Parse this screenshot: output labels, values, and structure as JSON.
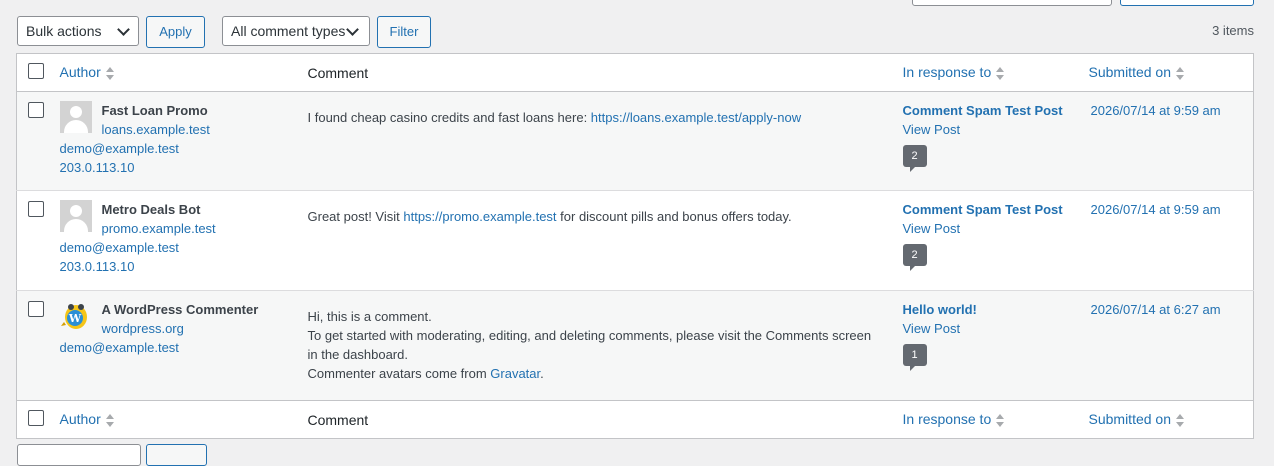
{
  "toolbar": {
    "bulk_actions": "Bulk actions",
    "apply": "Apply",
    "comment_types": "All comment types",
    "filter": "Filter",
    "items_count": "3 items"
  },
  "columns": {
    "author": "Author",
    "comment": "Comment",
    "in_response_to": "In response to",
    "submitted_on": "Submitted on"
  },
  "comments": [
    {
      "author_name": "Fast Loan Promo",
      "author_url": "loans.example.test",
      "author_email": "demo@example.test",
      "author_ip": "203.0.113.10",
      "avatar": "default-avatar-icon",
      "text_before": "I found cheap casino credits and fast loans here: ",
      "text_link": "https://loans.example.test/apply-now",
      "text_after": "",
      "post_title": "Comment Spam Test Post",
      "view_post": "View Post",
      "comment_count": "2",
      "submitted": "2026/07/14 at 9:59 am"
    },
    {
      "author_name": "Metro Deals Bot",
      "author_url": "promo.example.test",
      "author_email": "demo@example.test",
      "author_ip": "203.0.113.10",
      "avatar": "default-avatar-icon",
      "text_before": "Great post! Visit ",
      "text_link": "https://promo.example.test",
      "text_after": " for discount pills and bonus offers today.",
      "post_title": "Comment Spam Test Post",
      "view_post": "View Post",
      "comment_count": "2",
      "submitted": "2026/07/14 at 9:59 am"
    },
    {
      "author_name": "A WordPress Commenter",
      "author_url": "wordpress.org",
      "author_email": "demo@example.test",
      "avatar": "wapuu-avatar-icon",
      "line1": "Hi, this is a comment.",
      "line2": "To get started with moderating, editing, and deleting comments, please visit the Comments screen in the dashboard.",
      "line3_before": "Commenter avatars come from ",
      "line3_link": "Gravatar",
      "line3_after": ".",
      "post_title": "Hello world!",
      "view_post": "View Post",
      "comment_count": "1",
      "submitted": "2026/07/14 at 6:27 am"
    }
  ]
}
